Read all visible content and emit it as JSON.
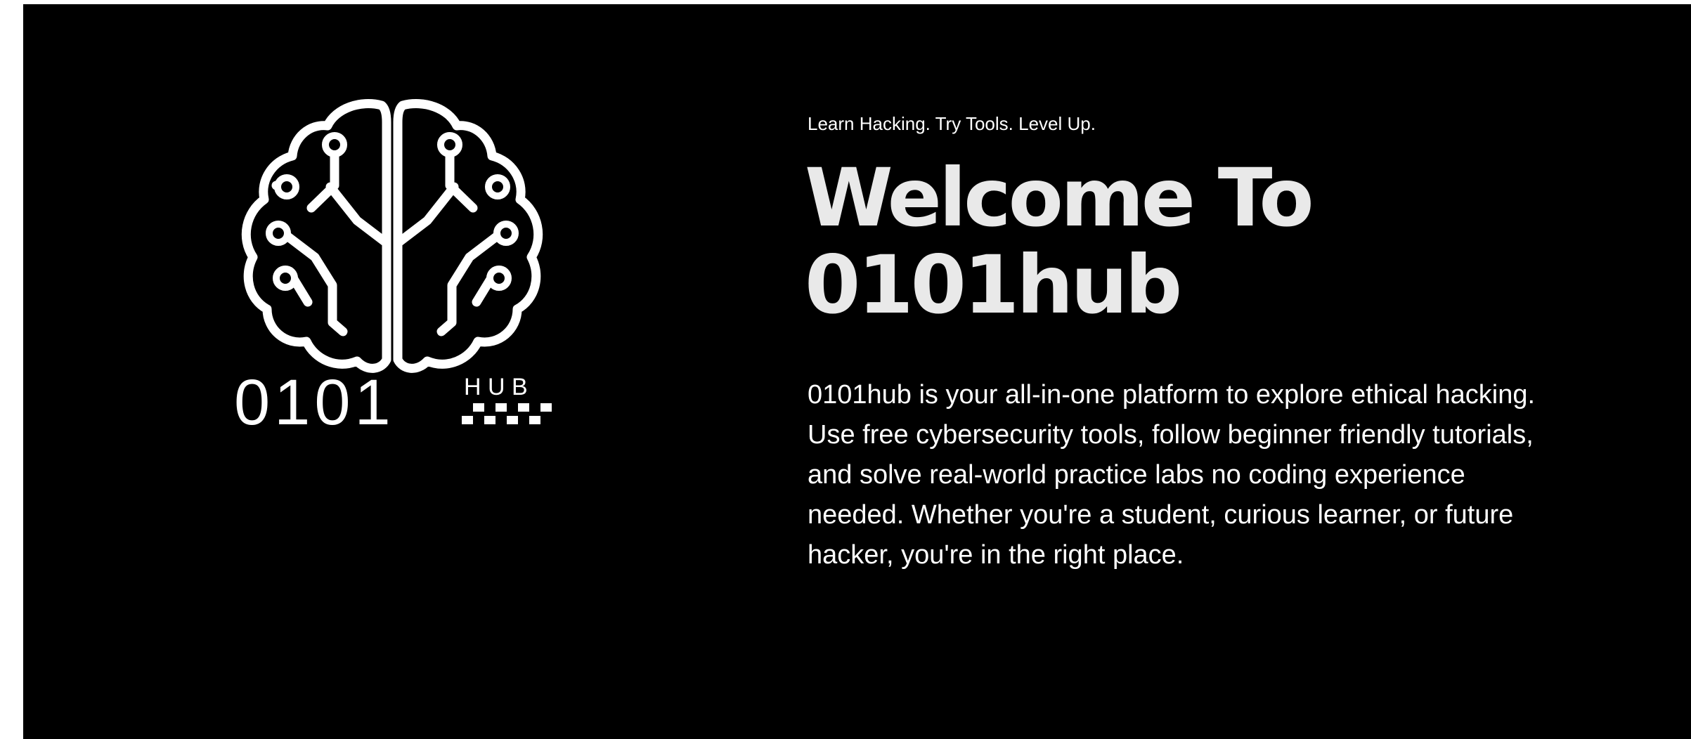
{
  "logo": {
    "icon": "brain-circuit-icon",
    "wordmark": "0101",
    "suffix": "H U B"
  },
  "hero": {
    "tagline": "Learn Hacking. Try Tools. Level Up.",
    "title_line1": "Welcome To",
    "title_line2": "0101hub",
    "description": "0101hub is your all-in-one platform to explore ethical hacking. Use free cybersecurity tools, follow beginner friendly tutorials, and solve real-world practice labs no coding experience needed. Whether you're a student, curious learner, or future hacker, you're in the right place."
  },
  "colors": {
    "background": "#000000",
    "title": "#e9e9e9",
    "text": "#ffffff"
  }
}
